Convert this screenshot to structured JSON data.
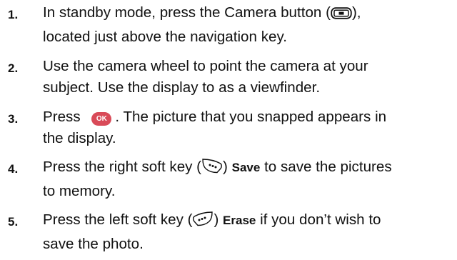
{
  "steps": [
    {
      "number": "1.",
      "lines": [
        {
          "before": "In standby mode, press the Camera button (",
          "icon": "camera-button-icon",
          "after": "),"
        },
        {
          "text": "located just above the navigation key."
        }
      ]
    },
    {
      "number": "2.",
      "lines": [
        {
          "text": "Use the camera wheel to point the camera at your"
        },
        {
          "text": "subject. Use the display to as a viewfinder."
        }
      ]
    },
    {
      "number": "3.",
      "lines": [
        {
          "before": "Press ",
          "key_label": "OK",
          "after": ". The picture that you snapped appears in"
        },
        {
          "text": "the display."
        }
      ]
    },
    {
      "number": "4.",
      "lines": [
        {
          "before": "Press the right soft key (",
          "icon": "right-soft-key-icon",
          "after": ") ",
          "bold": "Save",
          "rest": " to save the pictures"
        },
        {
          "text": "to memory."
        }
      ]
    },
    {
      "number": "5.",
      "lines": [
        {
          "before": "Press the left soft key (",
          "icon": "left-soft-key-icon",
          "after": ") ",
          "bold": "Erase",
          "rest": " if you don’t wish to"
        },
        {
          "text": "save the photo."
        }
      ]
    }
  ],
  "colors": {
    "text": "#111111",
    "ok_key": "#d94a58"
  }
}
